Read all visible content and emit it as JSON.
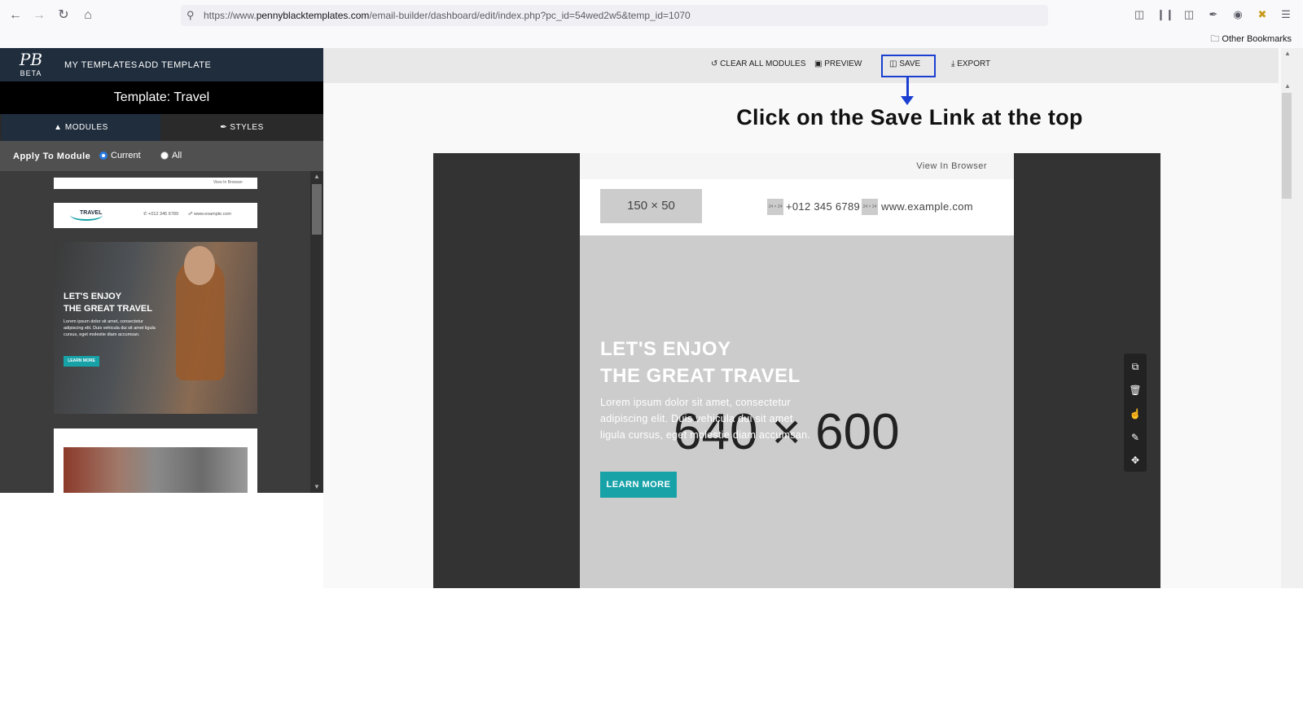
{
  "browser": {
    "url_prefix": "https://www.",
    "url_domain": "pennyblacktemplates.com",
    "url_path": "/email-builder/dashboard/edit/index.php?pc_id=54wed2w5&temp_id=1070",
    "other_bookmarks": "Other Bookmarks"
  },
  "app": {
    "logo_mark": "PB",
    "logo_beta": "BETA",
    "nav": [
      "MY TEMPLATES",
      "ADD TEMPLATE"
    ],
    "template_title": "Template: Travel",
    "tabs": [
      "MODULES",
      "STYLES"
    ],
    "apply_label": "Apply To Module",
    "apply_options": [
      "Current",
      "All"
    ],
    "apply_selected": "Current"
  },
  "thumbnails": {
    "view_in_browser": "View In Browser",
    "travel_logo": "TRAVEL",
    "phone": "+012 345 6789",
    "web": "www.example.com",
    "hero_title_1": "LET'S ENJOY",
    "hero_title_2": "THE GREAT TRAVEL",
    "hero_text": "Lorem ipsum dolor sit amet, consectetur adipiscing elit. Duis vehicula dui sit amet ligula cursus, eget molestie diam accumsan.",
    "hero_button": "LEARN MORE"
  },
  "toolbar": {
    "clear": "CLEAR ALL MODULES",
    "preview": "PREVIEW",
    "save": "SAVE",
    "export": "EXPORT"
  },
  "callout": "Click on the Save Link at the top",
  "email": {
    "view_in_browser": "View In Browser",
    "logo_placeholder": "150 × 50",
    "icon_placeholder": "24 × 24",
    "phone": "+012 345 6789",
    "web": "www.example.com",
    "hero_placeholder": "640 × 600",
    "hero_title_1": "LET'S ENJOY",
    "hero_title_2": "THE GREAT TRAVEL",
    "hero_text": "Lorem ipsum dolor sit amet, consectetur adipiscing elit. Duis vehicula dui sit amet ligula cursus, eget molestie diam accumsan.",
    "hero_button": "LEARN MORE"
  },
  "colors": {
    "accent_blue": "#1a3fd1",
    "button_teal": "#17a2a8",
    "nav_dark": "#1f2d3d"
  },
  "icons": [
    "back-icon",
    "forward-icon",
    "reload-icon",
    "home-icon",
    "search-icon",
    "pocket-icon",
    "library-icon",
    "sidebar-icon",
    "eyedropper-icon",
    "extension-icon",
    "menu-icon",
    "folder-icon",
    "reset-icon",
    "monitor-icon",
    "save-icon",
    "download-icon",
    "duplicate-icon",
    "trash-icon",
    "hand-icon",
    "paint-icon",
    "move-icon"
  ]
}
